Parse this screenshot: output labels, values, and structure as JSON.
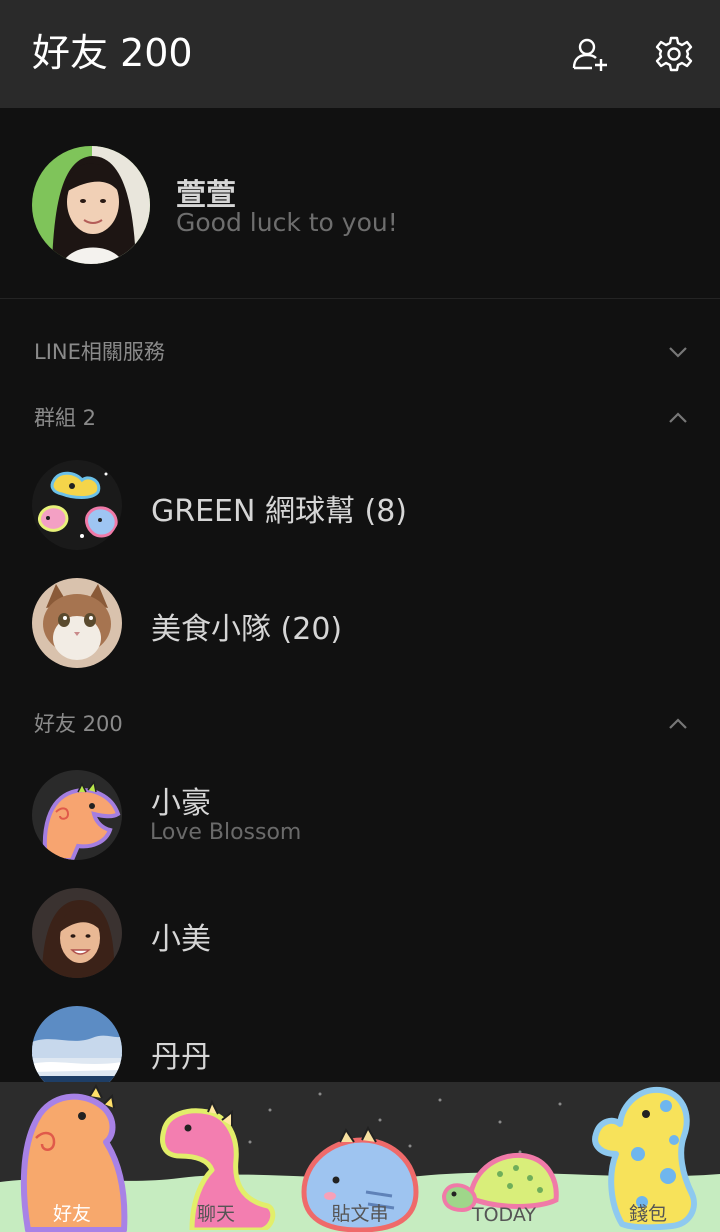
{
  "header": {
    "title": "好友 200",
    "add_friend_icon": "add-friend-icon",
    "settings_icon": "gear-icon"
  },
  "profile": {
    "name": "萱萱",
    "status": "Good luck to you!"
  },
  "sections": {
    "line_services": {
      "label": "LINE相關服務",
      "expanded": false
    },
    "groups": {
      "label": "群組 2",
      "expanded": true
    },
    "friends": {
      "label": "好友 200",
      "expanded": true
    }
  },
  "groups": [
    {
      "name": "GREEN 網球幫 (8)"
    },
    {
      "name": "美食小隊 (20)"
    }
  ],
  "friends": [
    {
      "name": "小豪",
      "status": "Love Blossom"
    },
    {
      "name": "小美",
      "status": ""
    },
    {
      "name": "丹丹",
      "status": ""
    }
  ],
  "tabs": [
    {
      "label": "好友",
      "active": true
    },
    {
      "label": "聊天",
      "active": false
    },
    {
      "label": "貼文串",
      "active": false
    },
    {
      "label": "TODAY",
      "active": false
    },
    {
      "label": "錢包",
      "active": false
    }
  ],
  "colors": {
    "header_bg": "#2a2a2a",
    "page_bg": "#111111",
    "tab_active": "#ffffff"
  }
}
